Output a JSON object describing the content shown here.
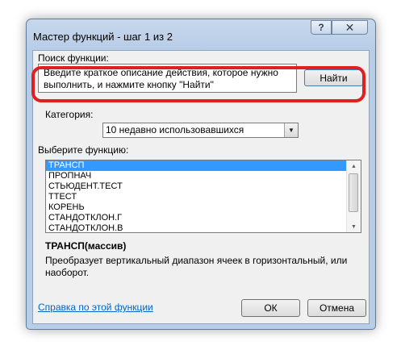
{
  "window": {
    "title": "Мастер функций - шаг 1 из 2",
    "help_glyph": "?",
    "close_glyph": "✕"
  },
  "search": {
    "label": "Поиск функции:",
    "value": "Введите краткое описание действия, которое нужно выполнить, и нажмите кнопку \"Найти\"",
    "find_button": "Найти"
  },
  "category": {
    "label": "Категория:",
    "selected": "10 недавно использовавшихся"
  },
  "function_list": {
    "label": "Выберите функцию:",
    "items": [
      "ТРАНСП",
      "ПРОПНАЧ",
      "СТЬЮДЕНТ.ТЕСТ",
      "ТТЕСТ",
      "КОРЕНЬ",
      "СТАНДОТКЛОН.Г",
      "СТАНДОТКЛОН.В"
    ],
    "selected_index": 0
  },
  "details": {
    "signature": "ТРАНСП(массив)",
    "description": "Преобразует вертикальный диапазон ячеек в горизонтальный, или наоборот."
  },
  "footer": {
    "help_link": "Справка по этой функции",
    "ok_button": "ОК",
    "cancel_button": "Отмена"
  },
  "colors": {
    "highlight": "#e02020",
    "selection": "#3399ff",
    "link": "#0066cc"
  }
}
